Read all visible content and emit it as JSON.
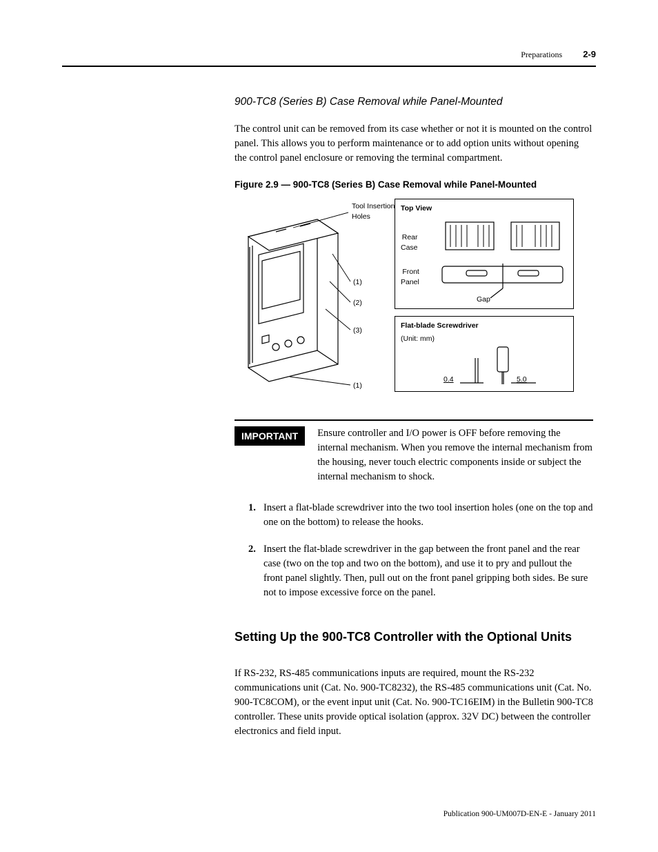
{
  "header": {
    "section": "Preparations",
    "page": "2-9"
  },
  "subheading": "900-TC8 (Series B) Case Removal while Panel-Mounted",
  "intro": "The control unit can be removed from its case whether or not it is mounted on the control panel. This allows you to perform maintenance or to add option units without opening the control panel enclosure or removing the terminal compartment.",
  "figure": {
    "caption": "Figure 2.9 — 900-TC8 (Series B) Case Removal while Panel-Mounted",
    "labels": {
      "tool_holes": "Tool Insertion\nHoles",
      "c1": "(1)",
      "c2": "(2)",
      "c3": "(3)",
      "c1b": "(1)",
      "top_view": "Top View",
      "rear_case": "Rear\nCase",
      "front_panel": "Front\nPanel",
      "gap": "Gap",
      "screwdriver_title": "Flat-blade Screwdriver",
      "unit": "(Unit: mm)",
      "dim_04": "0.4",
      "dim_50": "5.0"
    }
  },
  "important": {
    "label": "IMPORTANT",
    "text": "Ensure controller and I/O power is OFF before removing the internal mechanism. When you remove the internal mechanism from the housing, never touch electric components inside or subject the internal mechanism to shock."
  },
  "steps": [
    "Insert a flat-blade screwdriver into the two tool insertion holes (one on the top and one on the bottom) to release the hooks.",
    "Insert the flat-blade screwdriver in the gap between the front panel and the rear case (two on the top and two on the bottom), and use it to pry and pullout the front panel slightly. Then, pull out on the front panel gripping both sides. Be sure not to impose excessive force on the panel."
  ],
  "section_heading": "Setting Up the 900-TC8 Controller with the Optional Units",
  "section_body": "If RS-232, RS-485 communications inputs are required, mount the RS-232 communications unit (Cat. No. 900-TC8232), the RS-485 communications unit (Cat. No. 900-TC8COM), or the event input unit (Cat. No. 900-TC16EIM) in the Bulletin 900-TC8 controller. These units provide optical isolation (approx. 32V DC) between the controller electronics and field input.",
  "footer": "Publication 900-UM007D-EN-E - January 2011"
}
